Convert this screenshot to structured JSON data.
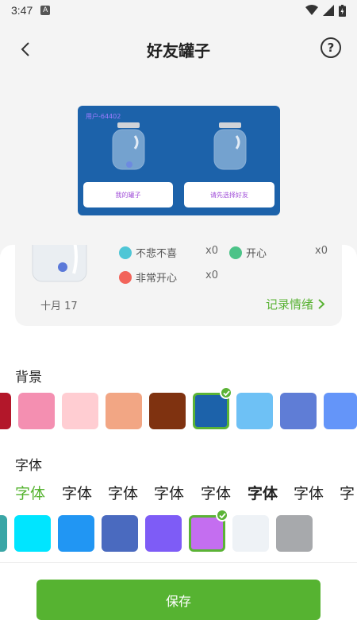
{
  "status": {
    "time": "3:47",
    "notification_icon": "A"
  },
  "header": {
    "title": "好友罐子",
    "back_icon": "chevron-left-icon",
    "help_icon": "?"
  },
  "preview": {
    "user_tag": "用户-64402",
    "left_button": "我的罐子",
    "right_button": "请先选择好友",
    "bg_color": "#1c62aa"
  },
  "stats": {
    "date": "十月 17",
    "moods": [
      {
        "label": "不悲不喜",
        "count": "x0",
        "color": "#4fc6d6"
      },
      {
        "label": "开心",
        "count": "x0",
        "color": "#4cc388"
      },
      {
        "label": "非常开心",
        "count": "x0",
        "color": "#f2645a"
      }
    ],
    "record_label": "记录情绪"
  },
  "background": {
    "label": "背景",
    "swatches": [
      "#b3172a",
      "#f48fb1",
      "#ffcdd2",
      "#f2a684",
      "#7f3210",
      "#1c62aa",
      "#6ec1f5",
      "#5f7dd6",
      "#6495f9"
    ],
    "selected_index": 5
  },
  "font": {
    "label": "字体",
    "items": [
      "字体",
      "字体",
      "字体",
      "字体",
      "字体",
      "字体",
      "字体",
      "字"
    ],
    "selected_index": 0
  },
  "font_color": {
    "swatches": [
      "#3aa6a6",
      "#00e5ff",
      "#2196f3",
      "#4a6abf",
      "#7e5cf6",
      "#c46ef0",
      "#eef2f6",
      "#a7a9ac"
    ],
    "selected_index": 5
  },
  "save_label": "保存",
  "accent_color": "#56b331"
}
